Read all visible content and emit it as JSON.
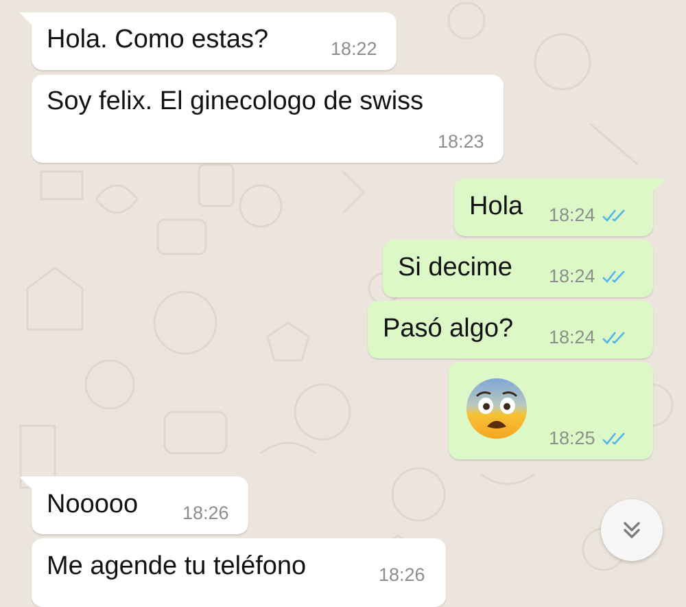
{
  "chat": {
    "messages": [
      {
        "direction": "incoming",
        "text": "Hola. Como estas?",
        "time": "18:22"
      },
      {
        "direction": "incoming",
        "text": "Soy felix. El ginecologo de swiss",
        "time": "18:23"
      },
      {
        "direction": "outgoing",
        "text": "Hola",
        "time": "18:24",
        "status": "read"
      },
      {
        "direction": "outgoing",
        "text": "Si decime",
        "time": "18:24",
        "status": "read"
      },
      {
        "direction": "outgoing",
        "text": "Pasó algo?",
        "time": "18:24",
        "status": "read"
      },
      {
        "direction": "outgoing",
        "emoji": "fearful-face",
        "time": "18:25",
        "status": "read"
      },
      {
        "direction": "incoming",
        "text": "Nooooo",
        "time": "18:26"
      },
      {
        "direction": "incoming",
        "text": "Me agende tu teléfono",
        "time": "18:26"
      }
    ]
  },
  "scroll_button": {
    "icon": "double-chevron-down-icon"
  },
  "colors": {
    "background": "#ece5dd",
    "incoming_bubble": "#ffffff",
    "outgoing_bubble": "#dcf8c6",
    "read_ticks": "#4fb6ec",
    "timestamp": "#8a8f8a"
  }
}
